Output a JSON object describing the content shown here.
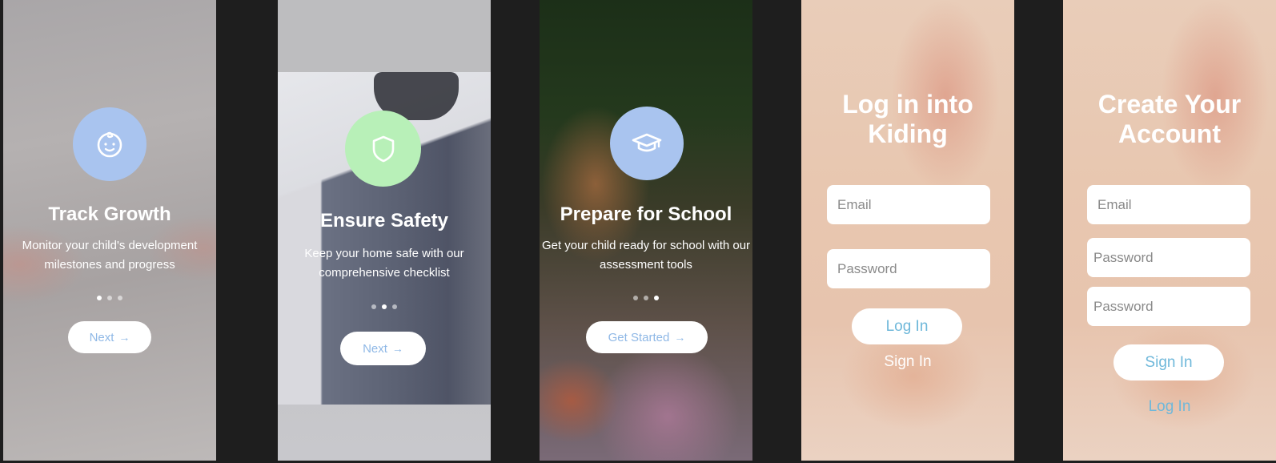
{
  "colors": {
    "blue_circle": "#a9c4ef",
    "green_circle": "#b8f0b8",
    "link_blue": "#6fb8da",
    "button_text": "#8fb8e6"
  },
  "onboarding": [
    {
      "icon": "baby-face-icon",
      "title": "Track Growth",
      "description": "Monitor your child's development milestones and progress",
      "active_dot": 1,
      "button": "Next"
    },
    {
      "icon": "shield-icon",
      "title": "Ensure Safety",
      "description": "Keep your home safe with our comprehensive checklist",
      "active_dot": 2,
      "button": "Next"
    },
    {
      "icon": "graduation-cap-icon",
      "title": "Prepare for School",
      "description": "Get your child ready for school with our assessment tools",
      "active_dot": 3,
      "button": "Get Started"
    }
  ],
  "login": {
    "title": "Log in into Kiding",
    "email_placeholder": "Email",
    "password_placeholder": "Password",
    "primary_button": "Log In",
    "secondary_link": "Sign In"
  },
  "signup": {
    "title": "Create Your Account",
    "email_placeholder": "Email",
    "password_placeholder": "Password",
    "confirm_placeholder": "Password",
    "primary_button": "Sign In",
    "secondary_link": "Log In"
  }
}
